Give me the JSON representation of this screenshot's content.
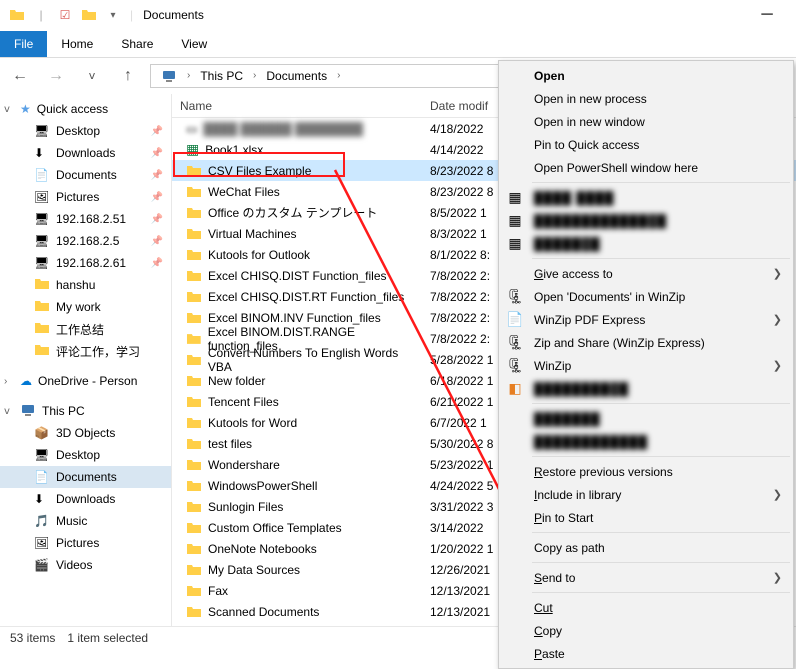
{
  "title": "Documents",
  "ribbon": {
    "file": "File",
    "home": "Home",
    "share": "Share",
    "view": "View"
  },
  "breadcrumb": {
    "pc": "This PC",
    "loc": "Documents"
  },
  "nav": {
    "quick": "Quick access",
    "quick_items": [
      "Desktop",
      "Downloads",
      "Documents",
      "Pictures",
      "192.168.2.51",
      "192.168.2.5",
      "192.168.2.61",
      "hanshu",
      "My work",
      "工作总结",
      "评论工作，学习"
    ],
    "onedrive": "OneDrive - Person",
    "thispc": "This PC",
    "pc_items": [
      "3D Objects",
      "Desktop",
      "Documents",
      "Downloads",
      "Music",
      "Pictures",
      "Videos"
    ]
  },
  "columns": {
    "name": "Name",
    "date": "Date modif"
  },
  "rows": [
    {
      "name": "",
      "date": "4/18/2022",
      "type": "blur"
    },
    {
      "name": "Book1.xlsx",
      "date": "4/14/2022",
      "type": "xlsx"
    },
    {
      "name": "CSV Files Example",
      "date": "8/23/2022 8",
      "type": "folder",
      "selected": true
    },
    {
      "name": "WeChat Files",
      "date": "8/23/2022 8",
      "type": "folder"
    },
    {
      "name": "Office のカスタム テンプレート",
      "date": "8/5/2022 1",
      "type": "folder"
    },
    {
      "name": "Virtual Machines",
      "date": "8/3/2022 1",
      "type": "folder"
    },
    {
      "name": "Kutools for Outlook",
      "date": "8/1/2022 8:",
      "type": "folder"
    },
    {
      "name": "Excel CHISQ.DIST Function_files",
      "date": "7/8/2022 2:",
      "type": "folder"
    },
    {
      "name": "Excel CHISQ.DIST.RT Function_files",
      "date": "7/8/2022 2:",
      "type": "folder"
    },
    {
      "name": "Excel BINOM.INV Function_files",
      "date": "7/8/2022 2:",
      "type": "folder"
    },
    {
      "name": "Excel BINOM.DIST.RANGE function_files",
      "date": "7/8/2022 2:",
      "type": "folder"
    },
    {
      "name": "Convert Numbers To English Words VBA",
      "date": "5/28/2022 1",
      "type": "folder"
    },
    {
      "name": "New folder",
      "date": "6/18/2022 1",
      "type": "folder"
    },
    {
      "name": "Tencent Files",
      "date": "6/21/2022 1",
      "type": "folder"
    },
    {
      "name": "Kutools for Word",
      "date": "6/7/2022 1",
      "type": "folder"
    },
    {
      "name": "test files",
      "date": "5/30/2022 8",
      "type": "folder"
    },
    {
      "name": "Wondershare",
      "date": "5/23/2022 1",
      "type": "folder"
    },
    {
      "name": "WindowsPowerShell",
      "date": "4/24/2022 5",
      "type": "folder"
    },
    {
      "name": "Sunlogin Files",
      "date": "3/31/2022 3",
      "type": "folder"
    },
    {
      "name": "Custom Office Templates",
      "date": "3/14/2022",
      "type": "folder"
    },
    {
      "name": "OneNote Notebooks",
      "date": "1/20/2022 1",
      "type": "folder"
    },
    {
      "name": "My Data Sources",
      "date": "12/26/2021",
      "type": "folder"
    },
    {
      "name": "Fax",
      "date": "12/13/2021",
      "type": "folder"
    },
    {
      "name": "Scanned Documents",
      "date": "12/13/2021",
      "type": "folder"
    }
  ],
  "ctx": {
    "open": "Open",
    "open_new_process": "Open in new process",
    "open_new_window": "Open in new window",
    "pin_quick": "Pin to Quick access",
    "open_ps": "Open PowerShell window here",
    "give_access": "Give access to",
    "open_winzip": "Open 'Documents' in WinZip",
    "winzip_pdf": "WinZip PDF Express",
    "zip_share": "Zip and Share (WinZip Express)",
    "winzip": "WinZip",
    "restore": "Restore previous versions",
    "include_lib": "Include in library",
    "pin_start": "Pin to Start",
    "copy_path": "Copy as path",
    "send_to": "Send to",
    "cut": "Cut",
    "copy": "Copy",
    "paste": "Paste"
  },
  "status": {
    "items": "53 items",
    "selected": "1 item selected"
  }
}
